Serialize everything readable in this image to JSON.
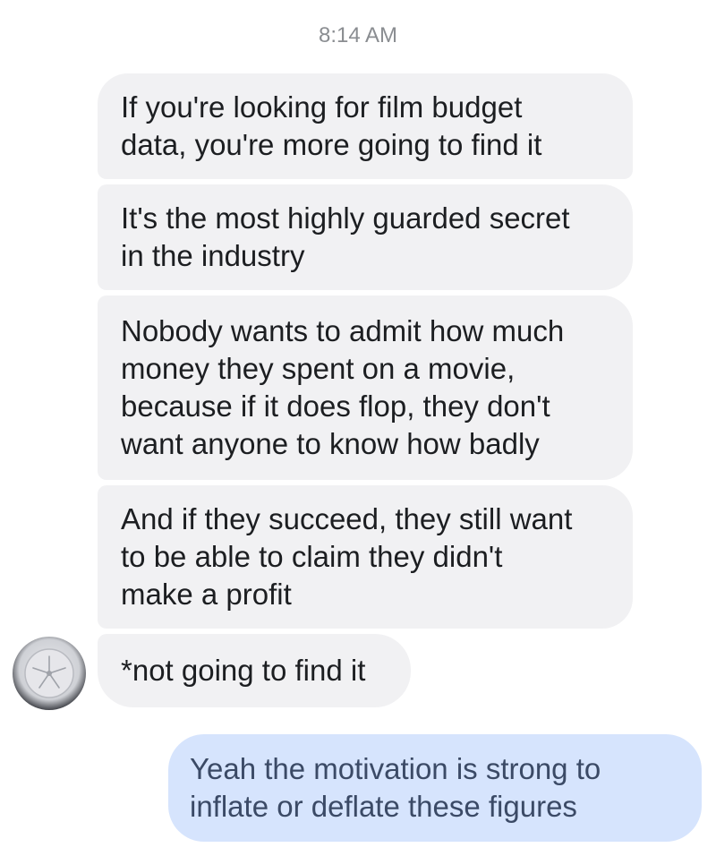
{
  "conversation": {
    "timestamp": "8:14 AM",
    "incoming": [
      {
        "text": "If you're looking for film budget\ndata, you're more going to find it"
      },
      {
        "text": "It's the most highly guarded secret\nin the industry"
      },
      {
        "text": "Nobody wants to admit how much\nmoney they spent on a movie,\nbecause if it does flop, they don't\nwant anyone to know how badly"
      },
      {
        "text": "And if they succeed, they still want\nto be able to claim they didn't\nmake a profit"
      },
      {
        "text": "*not going to find it"
      }
    ],
    "outgoing": [
      {
        "text": "Yeah the motivation is strong to\ninflate or deflate these figures"
      }
    ],
    "avatar_icon": "sand-dollar-icon"
  },
  "colors": {
    "incoming_bubble": "#f1f1f3",
    "outgoing_bubble": "#d6e4fd",
    "timestamp_text": "#8a8d91"
  }
}
